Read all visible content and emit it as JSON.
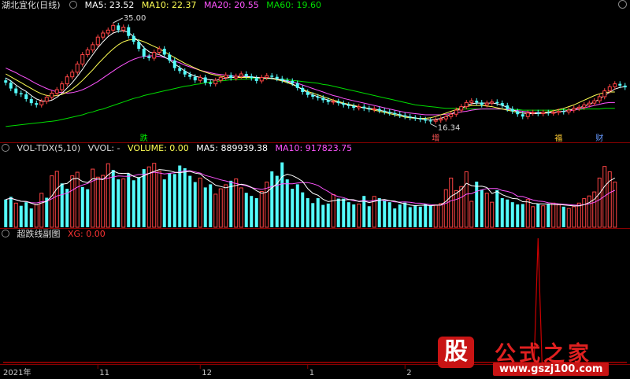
{
  "colors": {
    "bg": "#000000",
    "up": "#ff4444",
    "down": "#54fcfc",
    "ma5": "#ffffff",
    "ma10": "#ffff54",
    "ma20": "#ff54ff",
    "ma60": "#00dd00",
    "separator": "#8a0000",
    "xg": "#cc0000"
  },
  "price_panel": {
    "title": "湖北宜化(日线)",
    "ma5_label": "MA5:",
    "ma5_value": "23.52",
    "ma10_label": "MA10:",
    "ma10_value": "22.37",
    "ma20_label": "MA20:",
    "ma20_value": "20.55",
    "ma60_label": "MA60:",
    "ma60_value": "19.60",
    "high_marker": "35.00",
    "low_marker": "16.34",
    "event_markers": [
      "跌",
      "增",
      "福",
      "财"
    ]
  },
  "volume_panel": {
    "name": "VOL-TDX(5,10)",
    "vvol": "VVOL: -",
    "volume": "VOLUME: 0.00",
    "ma5": "MA5: 889939.38",
    "ma10": "MA10: 917823.75"
  },
  "indicator_panel": {
    "name": "超跌线副图",
    "xg": "XG: 0.00"
  },
  "time_axis": [
    "2021年",
    "11",
    "12",
    "1",
    "2"
  ],
  "watermark": {
    "logo": "股",
    "title": "公式之家",
    "url": "www.gszj100.com"
  },
  "icons": {
    "settings": "circle-icon",
    "corner": "circle-icon"
  },
  "chart_data": [
    {
      "type": "candlestick",
      "title": "湖北宜化(日线)",
      "x": [
        "2021-10",
        "2021-11",
        "2021-12",
        "2022-01",
        "2022-02"
      ],
      "ylim": [
        15,
        36
      ],
      "annotations": [
        {
          "label": "35.00",
          "kind": "high"
        },
        {
          "label": "16.34",
          "kind": "low"
        }
      ],
      "close": [
        24.0,
        23.0,
        22.2,
        22.0,
        21.2,
        20.5,
        20.2,
        20.8,
        21.5,
        22.2,
        22.8,
        23.8,
        25.0,
        25.8,
        27.2,
        28.8,
        29.6,
        30.5,
        31.8,
        32.5,
        33.0,
        33.8,
        33.0,
        33.5,
        32.0,
        31.0,
        29.8,
        28.5,
        28.2,
        29.2,
        29.8,
        28.8,
        27.8,
        26.5,
        26.0,
        25.4,
        25.0,
        24.4,
        24.9,
        24.0,
        23.8,
        24.4,
        24.9,
        25.3,
        24.8,
        25.1,
        25.5,
        25.1,
        24.8,
        24.3,
        24.9,
        25.2,
        25.0,
        24.7,
        24.4,
        24.3,
        23.9,
        23.1,
        22.4,
        21.9,
        21.6,
        21.4,
        21.0,
        20.7,
        20.8,
        20.5,
        20.2,
        20.0,
        19.7,
        19.9,
        19.6,
        19.4,
        19.5,
        19.2,
        19.0,
        18.8,
        18.6,
        18.4,
        18.2,
        18.0,
        17.9,
        17.7,
        17.5,
        17.4,
        17.6,
        17.8,
        18.2,
        18.6,
        19.3,
        19.9,
        20.6,
        20.9,
        20.6,
        20.2,
        20.5,
        20.7,
        20.5,
        20.1,
        19.5,
        19.1,
        18.6,
        18.2,
        18.8,
        18.9,
        18.7,
        18.9,
        18.8,
        18.9,
        19.1,
        19.0,
        19.3,
        19.6,
        19.8,
        20.2,
        20.5,
        20.9,
        21.6,
        22.6,
        23.3,
        23.8,
        23.5,
        23.2
      ],
      "open": [
        24.4,
        24.0,
        23.0,
        22.2,
        22.0,
        21.2,
        20.5,
        20.2,
        20.8,
        21.5,
        22.2,
        22.8,
        23.8,
        25.0,
        25.8,
        27.2,
        28.8,
        29.6,
        30.5,
        31.8,
        32.5,
        33.0,
        33.8,
        33.0,
        33.5,
        32.0,
        31.0,
        29.8,
        28.5,
        28.2,
        29.2,
        29.8,
        28.8,
        27.8,
        26.5,
        26.0,
        25.4,
        25.0,
        24.4,
        24.9,
        24.0,
        23.8,
        24.4,
        24.9,
        25.3,
        24.8,
        25.1,
        25.5,
        25.1,
        24.8,
        24.3,
        24.9,
        25.2,
        25.0,
        24.7,
        24.4,
        24.3,
        23.9,
        23.1,
        22.4,
        21.9,
        21.6,
        21.4,
        21.0,
        20.7,
        20.8,
        20.5,
        20.2,
        20.0,
        19.7,
        19.9,
        19.6,
        19.4,
        19.5,
        19.2,
        19.0,
        18.8,
        18.6,
        18.4,
        18.2,
        18.0,
        17.9,
        17.7,
        17.5,
        17.4,
        17.6,
        17.8,
        18.2,
        18.6,
        19.3,
        19.9,
        20.6,
        20.9,
        20.6,
        20.2,
        20.5,
        20.7,
        20.5,
        20.1,
        19.5,
        19.1,
        18.6,
        18.2,
        18.8,
        18.9,
        18.7,
        18.9,
        18.8,
        18.9,
        19.1,
        19.0,
        19.3,
        19.6,
        19.8,
        20.2,
        20.5,
        20.9,
        21.6,
        22.6,
        23.3,
        23.8,
        23.5
      ],
      "ma5": [
        24.8,
        24.3,
        23.6,
        23.0,
        22.5,
        21.8,
        21.2,
        20.9,
        20.8,
        21.0,
        21.5,
        22.2,
        23.1,
        24.0,
        25.1,
        26.3,
        27.6,
        28.8,
        30.0,
        31.0,
        31.9,
        32.5,
        32.8,
        32.9,
        32.6,
        31.9,
        31.0,
        30.0,
        29.3,
        29.0,
        28.8,
        28.4,
        27.9,
        27.2,
        26.6,
        26.0,
        25.5,
        25.1,
        24.9,
        24.6,
        24.5,
        24.4,
        24.6,
        24.8,
        24.9,
        25.0,
        25.1,
        25.1,
        25.0,
        24.9,
        24.8,
        24.8,
        24.8,
        24.6,
        24.4,
        24.2,
        23.8,
        23.3,
        22.8,
        22.3,
        21.9,
        21.6,
        21.3,
        21.0,
        20.8,
        20.6,
        20.4,
        20.2,
        20.0,
        19.8,
        19.7,
        19.6,
        19.5,
        19.3,
        19.1,
        18.9,
        18.7,
        18.5,
        18.3,
        18.1,
        18.0,
        17.8,
        17.7,
        17.6,
        17.7,
        17.9,
        18.2,
        18.6,
        19.1,
        19.6,
        20.1,
        20.4,
        20.5,
        20.5,
        20.5,
        20.5,
        20.4,
        20.1,
        19.8,
        19.4,
        19.0,
        18.8,
        18.7,
        18.7,
        18.7,
        18.8,
        18.8,
        18.9,
        19.0,
        19.1,
        19.3,
        19.5,
        19.7,
        20.0,
        20.3,
        20.7,
        21.2,
        21.8,
        22.4,
        22.9,
        23.2,
        23.3
      ],
      "ma10": [
        25.5,
        25.0,
        24.5,
        24.0,
        23.5,
        23.0,
        22.5,
        22.1,
        21.8,
        21.7,
        21.8,
        22.0,
        22.4,
        22.9,
        23.6,
        24.4,
        25.3,
        26.2,
        27.2,
        28.1,
        29.0,
        29.8,
        30.5,
        31.0,
        31.3,
        31.4,
        31.3,
        31.0,
        30.6,
        30.2,
        29.8,
        29.3,
        28.8,
        28.3,
        27.8,
        27.3,
        26.9,
        26.5,
        26.1,
        25.8,
        25.5,
        25.3,
        25.1,
        25.0,
        24.9,
        24.9,
        24.9,
        24.9,
        24.9,
        24.9,
        24.8,
        24.8,
        24.7,
        24.5,
        24.3,
        24.0,
        23.7,
        23.3,
        22.9,
        22.5,
        22.2,
        21.9,
        21.6,
        21.3,
        21.0,
        20.8,
        20.5,
        20.3,
        20.1,
        19.9,
        19.7,
        19.5,
        19.3,
        19.1,
        18.9,
        18.7,
        18.5,
        18.3,
        18.1,
        18.0,
        17.9,
        17.9,
        17.9,
        18.0,
        18.2,
        18.5,
        18.8,
        19.1,
        19.4,
        19.7,
        19.9,
        20.1,
        20.1,
        20.1,
        20.0,
        19.9,
        19.7,
        19.5,
        19.3,
        19.1,
        18.9,
        18.8,
        18.8,
        18.8,
        18.8,
        18.9,
        19.0,
        19.2,
        19.4,
        19.6,
        19.9,
        20.2,
        20.6,
        21.0,
        21.4,
        21.8,
        22.1,
        22.3,
        22.4,
        22.4
      ],
      "ma20": [
        26.5,
        26.1,
        25.7,
        25.2,
        24.8,
        24.3,
        23.8,
        23.4,
        23.0,
        22.7,
        22.4,
        22.3,
        22.2,
        22.3,
        22.5,
        22.8,
        23.2,
        23.7,
        24.2,
        24.8,
        25.4,
        26.0,
        26.6,
        27.1,
        27.6,
        28.0,
        28.3,
        28.5,
        28.6,
        28.6,
        28.5,
        28.3,
        28.0,
        27.7,
        27.4,
        27.0,
        26.7,
        26.4,
        26.1,
        25.9,
        25.7,
        25.5,
        25.4,
        25.3,
        25.2,
        25.1,
        25.1,
        25.0,
        25.0,
        24.9,
        24.9,
        24.8,
        24.7,
        24.6,
        24.5,
        24.3,
        24.1,
        23.9,
        23.6,
        23.3,
        23.0,
        22.7,
        22.4,
        22.1,
        21.8,
        21.6,
        21.3,
        21.1,
        20.9,
        20.7,
        20.5,
        20.3,
        20.1,
        19.9,
        19.7,
        19.5,
        19.3,
        19.1,
        18.9,
        18.8,
        18.7,
        18.6,
        18.5,
        18.5,
        18.5,
        18.5,
        18.6,
        18.7,
        18.8,
        19.0,
        19.1,
        19.3,
        19.4,
        19.5,
        19.5,
        19.5,
        19.5,
        19.5,
        19.4,
        19.3,
        19.2,
        19.1,
        19.0,
        18.9,
        18.9,
        18.9,
        18.9,
        18.9,
        19.0,
        19.1,
        19.2,
        19.3,
        19.5,
        19.7,
        19.9,
        20.1,
        20.3,
        20.5,
        20.6,
        20.6
      ],
      "ma60": [
        16.5,
        16.6,
        16.7,
        16.8,
        16.9,
        17.0,
        17.1,
        17.2,
        17.3,
        17.4,
        17.5,
        17.7,
        17.9,
        18.1,
        18.3,
        18.5,
        18.8,
        19.0,
        19.3,
        19.5,
        19.8,
        20.1,
        20.4,
        20.7,
        21.0,
        21.3,
        21.5,
        21.8,
        22.0,
        22.2,
        22.4,
        22.6,
        22.8,
        23.0,
        23.2,
        23.4,
        23.5,
        23.7,
        23.8,
        24.0,
        24.1,
        24.2,
        24.3,
        24.4,
        24.5,
        24.5,
        24.6,
        24.6,
        24.7,
        24.7,
        24.7,
        24.7,
        24.7,
        24.6,
        24.6,
        24.5,
        24.4,
        24.3,
        24.2,
        24.1,
        24.0,
        23.9,
        23.7,
        23.6,
        23.4,
        23.2,
        23.0,
        22.8,
        22.6,
        22.4,
        22.2,
        22.0,
        21.8,
        21.6,
        21.4,
        21.2,
        21.0,
        20.8,
        20.6,
        20.4,
        20.2,
        20.1,
        20.0,
        19.9,
        19.8,
        19.7,
        19.6,
        19.6,
        19.6,
        19.5,
        19.5,
        19.5,
        19.5,
        19.5,
        19.5,
        19.5,
        19.5,
        19.5,
        19.4,
        19.4,
        19.4,
        19.3,
        19.3,
        19.3,
        19.3,
        19.3,
        19.3,
        19.3,
        19.3,
        19.4,
        19.4,
        19.4,
        19.4,
        19.5,
        19.5,
        19.5,
        19.5,
        19.6,
        19.6,
        19.6
      ]
    },
    {
      "type": "bar",
      "title": "VOL-TDX(5,10)",
      "y_unit": "lots",
      "ylim": [
        0,
        1600000
      ],
      "values": [
        620000,
        680000,
        540000,
        480000,
        560000,
        420000,
        500000,
        760000,
        660000,
        1150000,
        1250000,
        980000,
        860000,
        1150000,
        1230000,
        900000,
        850000,
        1300000,
        1120000,
        1160000,
        1420000,
        1280000,
        1070000,
        1080000,
        1200000,
        1050000,
        1120000,
        1300000,
        1350000,
        1430000,
        1250000,
        1070000,
        1210000,
        1190000,
        1380000,
        1320000,
        1150000,
        1010000,
        1100000,
        890000,
        960000,
        740000,
        860000,
        950000,
        1040000,
        1080000,
        880000,
        770000,
        700000,
        650000,
        800000,
        1010000,
        1250000,
        1150000,
        1450000,
        1070000,
        860000,
        960000,
        780000,
        650000,
        540000,
        650000,
        500000,
        530000,
        730000,
        640000,
        640000,
        560000,
        510000,
        520000,
        700000,
        470000,
        690000,
        650000,
        600000,
        560000,
        420000,
        510000,
        550000,
        450000,
        490000,
        460000,
        520000,
        490000,
        500000,
        530000,
        840000,
        1100000,
        820000,
        910000,
        1240000,
        580000,
        1020000,
        840000,
        760000,
        560000,
        830000,
        650000,
        620000,
        560000,
        510000,
        520000,
        620000,
        460000,
        520000,
        480000,
        520000,
        540000,
        500000,
        460000,
        420000,
        460000,
        540000,
        640000,
        700000,
        790000,
        1100000,
        1360000,
        1240000,
        1010000
      ],
      "up": [
        0,
        0,
        1,
        0,
        0,
        0,
        1,
        1,
        0,
        1,
        1,
        0,
        0,
        1,
        1,
        0,
        0,
        1,
        1,
        1,
        1,
        0,
        0,
        1,
        0,
        0,
        0,
        0,
        1,
        1,
        1,
        0,
        0,
        0,
        0,
        0,
        0,
        0,
        1,
        0,
        0,
        1,
        1,
        1,
        0,
        1,
        1,
        0,
        0,
        0,
        1,
        1,
        0,
        0,
        0,
        0,
        0,
        0,
        0,
        0,
        0,
        0,
        0,
        0,
        1,
        0,
        0,
        0,
        0,
        1,
        0,
        0,
        1,
        0,
        0,
        0,
        0,
        0,
        0,
        0,
        0,
        0,
        0,
        0,
        1,
        1,
        1,
        1,
        1,
        1,
        1,
        1,
        0,
        0,
        1,
        1,
        0,
        0,
        0,
        0,
        0,
        0,
        1,
        1,
        0,
        1,
        0,
        1,
        1,
        0,
        1,
        1,
        1,
        1,
        1,
        1,
        1,
        1,
        1,
        1,
        0,
        0
      ],
      "series": [
        {
          "name": "MA5"
        },
        {
          "name": "MA10"
        }
      ]
    },
    {
      "type": "line",
      "title": "超跌线副图",
      "series": [
        {
          "name": "XG",
          "spike_index": 104,
          "value": 1,
          "ylim": [
            0,
            1
          ]
        }
      ]
    }
  ]
}
